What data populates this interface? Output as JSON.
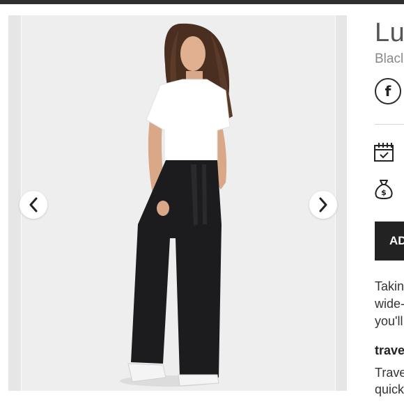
{
  "product": {
    "title": "Lu",
    "color": "Blacl",
    "add_button_label": "AD",
    "description_lines": [
      "Takin",
      "wide-",
      "you'll"
    ],
    "feature_heading": "trave",
    "feature_lines": [
      "Trave",
      "quick"
    ]
  },
  "gallery": {
    "prev_icon": "chevron-left-icon",
    "next_icon": "chevron-right-icon"
  },
  "share": {
    "icon": "facebook-icon"
  },
  "info_icons": [
    "calendar-check-icon",
    "money-bag-icon"
  ],
  "colors": {
    "button": "#222222",
    "topbar": "#2f2f2f",
    "gallery_bg": "#eeeeee"
  }
}
